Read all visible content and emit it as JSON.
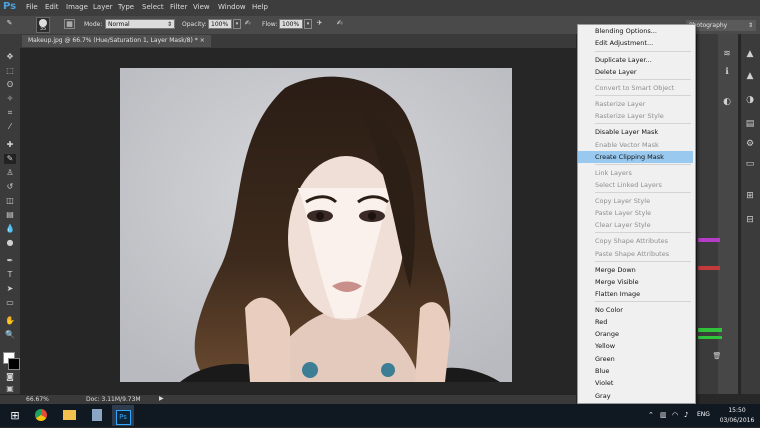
{
  "menubar": {
    "logo": "Ps",
    "items": [
      "File",
      "Edit",
      "Image",
      "Layer",
      "Type",
      "Select",
      "Filter",
      "View",
      "Window",
      "Help"
    ]
  },
  "options": {
    "brush_size": "35",
    "mode_label": "Mode:",
    "mode_value": "Normal",
    "opacity_label": "Opacity:",
    "opacity_value": "100%",
    "flow_label": "Flow:",
    "flow_value": "100%",
    "workspace": "Photography"
  },
  "document": {
    "tab_title": "Makeup.jpg @ 66.7% (Hue/Saturation 1, Layer Mask/8) *",
    "close_glyph": "×"
  },
  "statusbar": {
    "zoom": "66.67%",
    "doc_info": "Doc: 3.11M/9.73M"
  },
  "context_menu": {
    "items": [
      {
        "label": "Blending Options...",
        "disabled": false,
        "highlighted": false
      },
      {
        "label": "Edit Adjustment...",
        "disabled": false,
        "highlighted": false
      },
      {
        "label": "Duplicate Layer...",
        "disabled": false,
        "highlighted": false
      },
      {
        "label": "Delete Layer",
        "disabled": false,
        "highlighted": false
      },
      {
        "label": "Convert to Smart Object",
        "disabled": true,
        "highlighted": false
      },
      {
        "label": "Rasterize Layer",
        "disabled": true,
        "highlighted": false
      },
      {
        "label": "Rasterize Layer Style",
        "disabled": true,
        "highlighted": false
      },
      {
        "label": "Disable Layer Mask",
        "disabled": false,
        "highlighted": false
      },
      {
        "label": "Enable Vector Mask",
        "disabled": true,
        "highlighted": false
      },
      {
        "label": "Create Clipping Mask",
        "disabled": false,
        "highlighted": true
      },
      {
        "label": "Link Layers",
        "disabled": true,
        "highlighted": false
      },
      {
        "label": "Select Linked Layers",
        "disabled": true,
        "highlighted": false
      },
      {
        "label": "Copy Layer Style",
        "disabled": true,
        "highlighted": false
      },
      {
        "label": "Paste Layer Style",
        "disabled": true,
        "highlighted": false
      },
      {
        "label": "Clear Layer Style",
        "disabled": true,
        "highlighted": false
      },
      {
        "label": "Copy Shape Attributes",
        "disabled": true,
        "highlighted": false
      },
      {
        "label": "Paste Shape Attributes",
        "disabled": true,
        "highlighted": false
      },
      {
        "label": "Merge Down",
        "disabled": false,
        "highlighted": false
      },
      {
        "label": "Merge Visible",
        "disabled": false,
        "highlighted": false
      },
      {
        "label": "Flatten Image",
        "disabled": false,
        "highlighted": false
      },
      {
        "label": "No Color",
        "disabled": false,
        "highlighted": false
      },
      {
        "label": "Red",
        "disabled": false,
        "highlighted": false
      },
      {
        "label": "Orange",
        "disabled": false,
        "highlighted": false
      },
      {
        "label": "Yellow",
        "disabled": false,
        "highlighted": false
      },
      {
        "label": "Green",
        "disabled": false,
        "highlighted": false
      },
      {
        "label": "Blue",
        "disabled": false,
        "highlighted": false
      },
      {
        "label": "Violet",
        "disabled": false,
        "highlighted": false
      },
      {
        "label": "Gray",
        "disabled": false,
        "highlighted": false
      }
    ]
  },
  "taskbar": {
    "lang": "ENG",
    "time": "15:50",
    "date": "03/06/2016"
  },
  "colors": {
    "highlight": "#99c9ef",
    "ps_blue": "#4aa3df"
  }
}
